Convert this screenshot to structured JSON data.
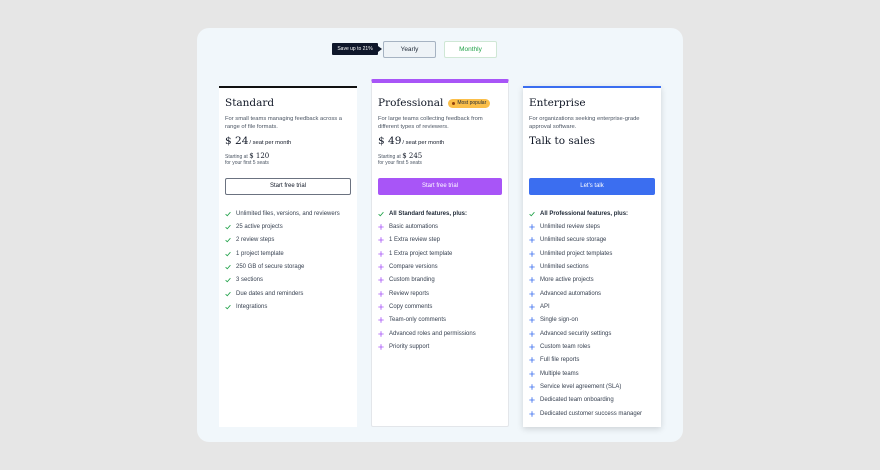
{
  "toggle": {
    "badge": "Save up to 21%",
    "yearly": "Yearly",
    "monthly": "Monthly"
  },
  "colors": {
    "green": "#22a34a",
    "purple": "#a855f7",
    "blue": "#3b6ef0"
  },
  "plans": [
    {
      "title": "Standard",
      "desc": "For small teams managing feedback across a range of file formats.",
      "price": "$ 24",
      "per": "/ seat per month",
      "starting_prefix": "Starting at",
      "starting_amount": "$ 120",
      "first_seats": "for your first 5 seats",
      "cta": "Start free trial",
      "features": [
        {
          "text": "Unlimited files, versions, and reviewers",
          "icon": "check-icon"
        },
        {
          "text": "25 active projects",
          "icon": "check-icon"
        },
        {
          "text": "2 review steps",
          "icon": "check-icon"
        },
        {
          "text": "1 project template",
          "icon": "check-icon"
        },
        {
          "text": "250 GB of secure storage",
          "icon": "check-icon"
        },
        {
          "text": "3 sections",
          "icon": "check-icon"
        },
        {
          "text": "Due dates and reminders",
          "icon": "check-icon"
        },
        {
          "text": "Integrations",
          "icon": "check-icon"
        }
      ]
    },
    {
      "title": "Professional",
      "badge": "Most popular",
      "desc": "For large teams collecting feedback from different types of reviewers.",
      "price": "$ 49",
      "per": "/ seat per month",
      "starting_prefix": "Starting at",
      "starting_amount": "$ 245",
      "first_seats": "for your first 5 seats",
      "cta": "Start free trial",
      "features": [
        {
          "text": "All Standard features, plus:",
          "icon": "check-icon",
          "strong": true
        },
        {
          "text": "Basic automations",
          "icon": "plus-icon"
        },
        {
          "text": "1 Extra review step",
          "icon": "plus-icon"
        },
        {
          "text": "1 Extra project template",
          "icon": "plus-icon"
        },
        {
          "text": "Compare versions",
          "icon": "plus-icon"
        },
        {
          "text": "Custom branding",
          "icon": "plus-icon"
        },
        {
          "text": "Review reports",
          "icon": "plus-icon"
        },
        {
          "text": "Copy comments",
          "icon": "plus-icon"
        },
        {
          "text": "Team-only comments",
          "icon": "plus-icon"
        },
        {
          "text": "Advanced roles and permissions",
          "icon": "plus-icon"
        },
        {
          "text": "Priority support",
          "icon": "plus-icon"
        }
      ]
    },
    {
      "title": "Enterprise",
      "desc": "For organizations seeking enterprise-grade approval software.",
      "talk": "Talk to sales",
      "cta": "Let's talk",
      "features": [
        {
          "text": "All Professional features, plus:",
          "icon": "check-icon",
          "strong": true
        },
        {
          "text": "Unlimited review steps",
          "icon": "plus-icon"
        },
        {
          "text": "Unlimited secure storage",
          "icon": "plus-icon"
        },
        {
          "text": "Unlimited project templates",
          "icon": "plus-icon"
        },
        {
          "text": "Unlimited sections",
          "icon": "plus-icon"
        },
        {
          "text": "More active projects",
          "icon": "plus-icon"
        },
        {
          "text": "Advanced automations",
          "icon": "plus-icon"
        },
        {
          "text": "API",
          "icon": "plus-icon"
        },
        {
          "text": "Single sign-on",
          "icon": "plus-icon"
        },
        {
          "text": "Advanced security settings",
          "icon": "plus-icon"
        },
        {
          "text": "Custom team roles",
          "icon": "plus-icon"
        },
        {
          "text": "Full file reports",
          "icon": "plus-icon"
        },
        {
          "text": "Multiple teams",
          "icon": "plus-icon"
        },
        {
          "text": "Service level agreement (SLA)",
          "icon": "plus-icon"
        },
        {
          "text": "Dedicated team onboarding",
          "icon": "plus-icon"
        },
        {
          "text": "Dedicated customer success manager",
          "icon": "plus-icon"
        }
      ]
    }
  ]
}
